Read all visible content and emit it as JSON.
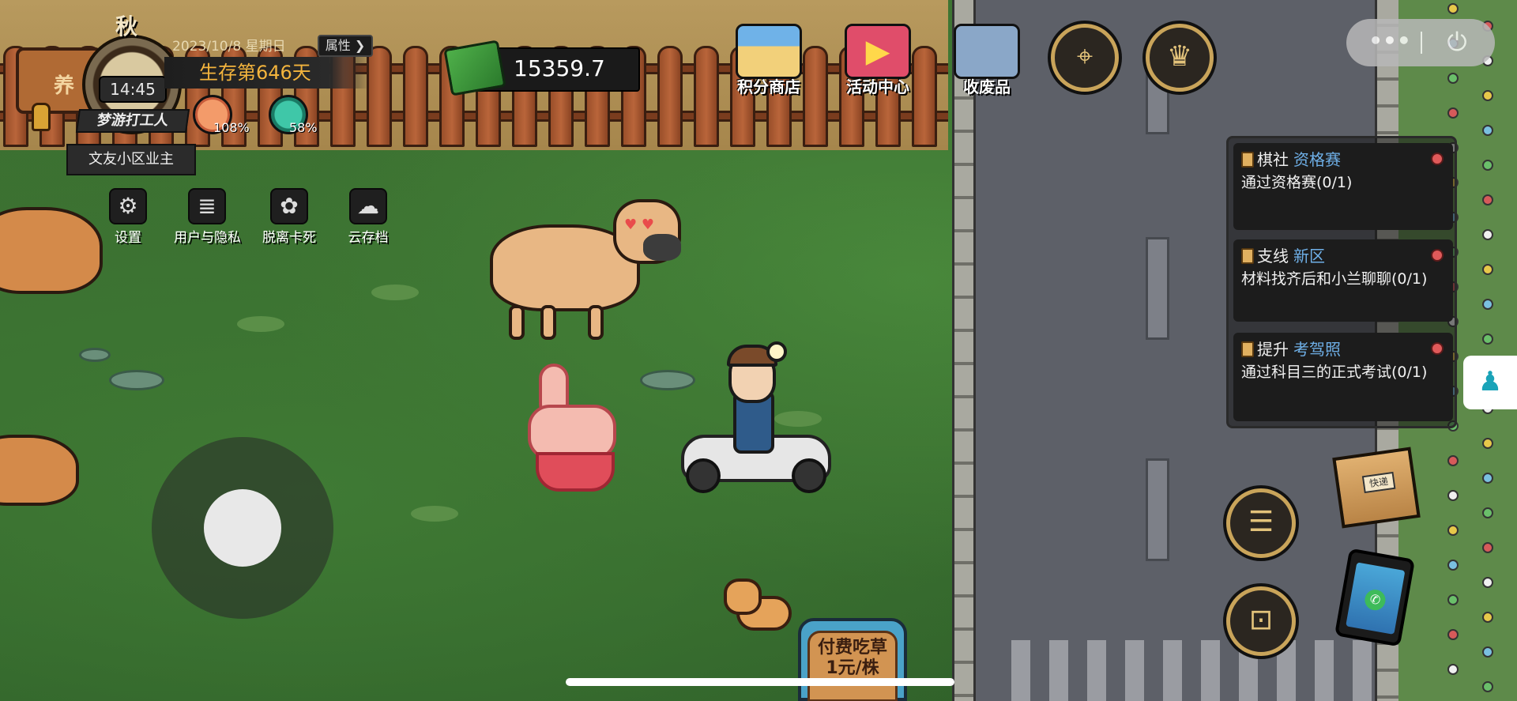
{
  "hud": {
    "season": "秋",
    "clock_time": "14:45",
    "date": "2023/10/8 星期日",
    "attributes_button": "属性 ❯",
    "survival_days": "生存第646天",
    "worker_banner": "梦游打工人",
    "hunger_pct": "108%",
    "health_pct": "58%",
    "owner_tag": "文友小区业主",
    "signboard_char": "养"
  },
  "menu": {
    "settings": "设置",
    "privacy": "用户与隐私",
    "unstuck": "脱离卡死",
    "cloud_save": "云存档"
  },
  "money": {
    "value": "15359.7"
  },
  "top_buttons": {
    "points_shop": "积分商店",
    "activity_center": "活动中心",
    "recycling": "收废品"
  },
  "icons": {
    "map": "map-icon",
    "trophy": "trophy-icon",
    "more": "more-icon",
    "power": "power-icon",
    "quest_log": "clipboard-icon",
    "backpack": "backpack-icon",
    "parcel": "parcel-icon",
    "phone": "phone-icon",
    "side_tab": "joystick-icon"
  },
  "capsule": {
    "dots": "•••",
    "power": "⏻"
  },
  "quests": [
    {
      "type": "棋社",
      "name": "资格赛",
      "desc": "通过资格赛(0/1)"
    },
    {
      "type": "支线",
      "name": "新区",
      "desc": "材料找齐后和小兰聊聊(0/1)"
    },
    {
      "type": "提升",
      "name": "考驾照",
      "desc": "通过科目三的正式考试(0/1)"
    }
  ],
  "parcel": {
    "tag": "快递"
  },
  "sign": {
    "text": "付费吃草 1元/株"
  },
  "colors": {
    "quest_name": "#6fb0e8",
    "survival_text": "#f3b43d",
    "button_rim": "#c9a45a"
  }
}
